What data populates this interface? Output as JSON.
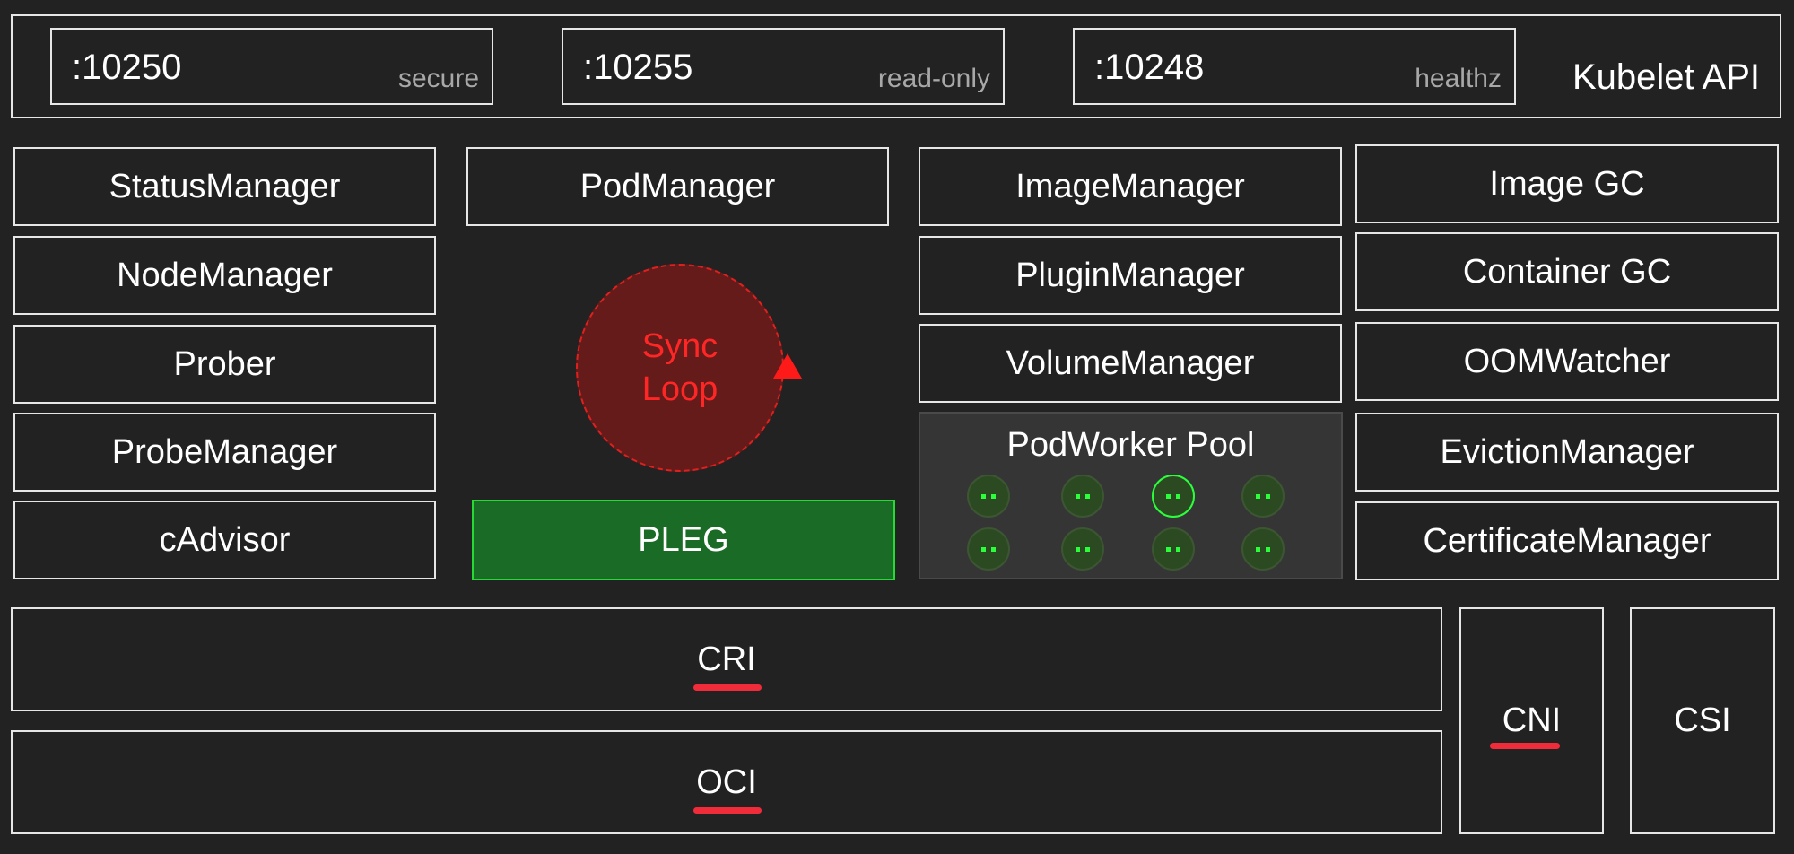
{
  "api": {
    "title": "Kubelet API",
    "ports": [
      {
        "port": ":10250",
        "tag": "secure"
      },
      {
        "port": ":10255",
        "tag": "read-only"
      },
      {
        "port": ":10248",
        "tag": "healthz"
      }
    ]
  },
  "left_column": [
    "StatusManager",
    "NodeManager",
    "Prober",
    "ProbeManager",
    "cAdvisor"
  ],
  "pod_manager": "PodManager",
  "sync_loop": {
    "line1": "Sync",
    "line2": "Loop"
  },
  "pleg": "PLEG",
  "right_mid_column": [
    "ImageManager",
    "PluginManager",
    "VolumeManager"
  ],
  "pod_worker_pool": {
    "title": "PodWorker Pool",
    "worker_count": 8,
    "active_worker_index": 2
  },
  "right_column": [
    "Image GC",
    "Container GC",
    "OOMWatcher",
    "EvictionManager",
    "CertificateManager"
  ],
  "runtime": {
    "cri": "CRI",
    "oci": "OCI",
    "cni": "CNI",
    "csi": "CSI"
  },
  "colors": {
    "background": "#222222",
    "border": "#e6e6e6",
    "sync_loop_fill": "#661b1b",
    "sync_loop_text": "#ff2626",
    "pleg_fill": "#1a6b25",
    "pleg_border": "#27d934",
    "worker_dot": "#2bff3b",
    "underline": "#f02b3a"
  }
}
